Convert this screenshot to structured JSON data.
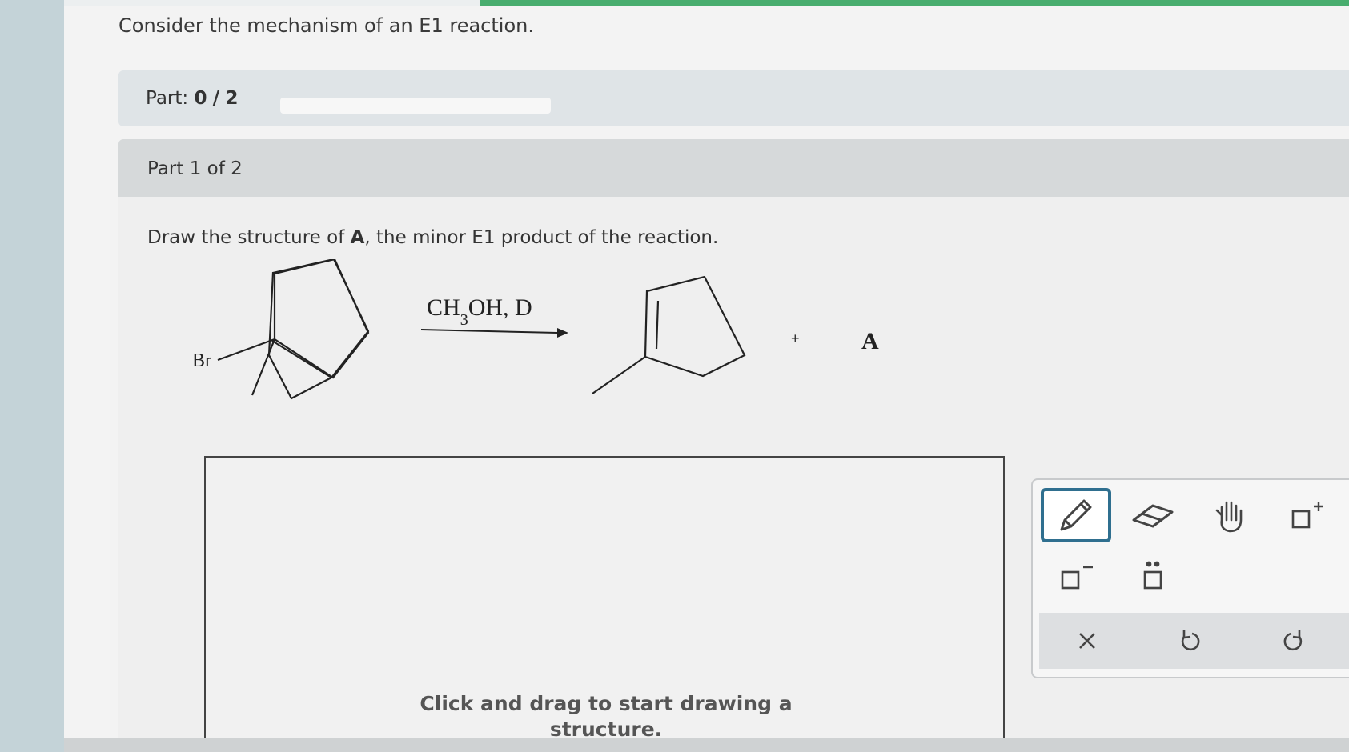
{
  "question": {
    "title": "Consider the mechanism of an E1 reaction."
  },
  "part_bar": {
    "label": "Part:",
    "completed": "0",
    "separator": "/",
    "total": "2",
    "progress_fraction": 0
  },
  "part_card": {
    "header": "Part 1 of 2",
    "instruction_pre": "Draw the structure of ",
    "instruction_bold": "A",
    "instruction_post": ", the minor E1 product of the reaction."
  },
  "reaction": {
    "reactant_substituent": "Br",
    "reagent_main": "CH",
    "reagent_subscript": "3",
    "reagent_rest": "OH, D",
    "plus_sign": "+",
    "product_label": "A"
  },
  "canvas": {
    "hint_line1": "Click and drag to start drawing a",
    "hint_line2": "structure."
  },
  "toolbar": {
    "tools": [
      {
        "name": "pencil-icon",
        "active": true
      },
      {
        "name": "eraser-icon",
        "active": false
      },
      {
        "name": "hand-icon",
        "active": false
      },
      {
        "name": "add-positive-charge-icon",
        "active": false
      },
      {
        "name": "add-negative-charge-icon",
        "active": false
      },
      {
        "name": "lone-pair-icon",
        "active": false
      }
    ],
    "actions": [
      {
        "name": "clear-icon"
      },
      {
        "name": "undo-icon"
      },
      {
        "name": "redo-icon"
      }
    ],
    "colors": {
      "active_border": "#2f6f8f",
      "icon": "#444444"
    }
  }
}
